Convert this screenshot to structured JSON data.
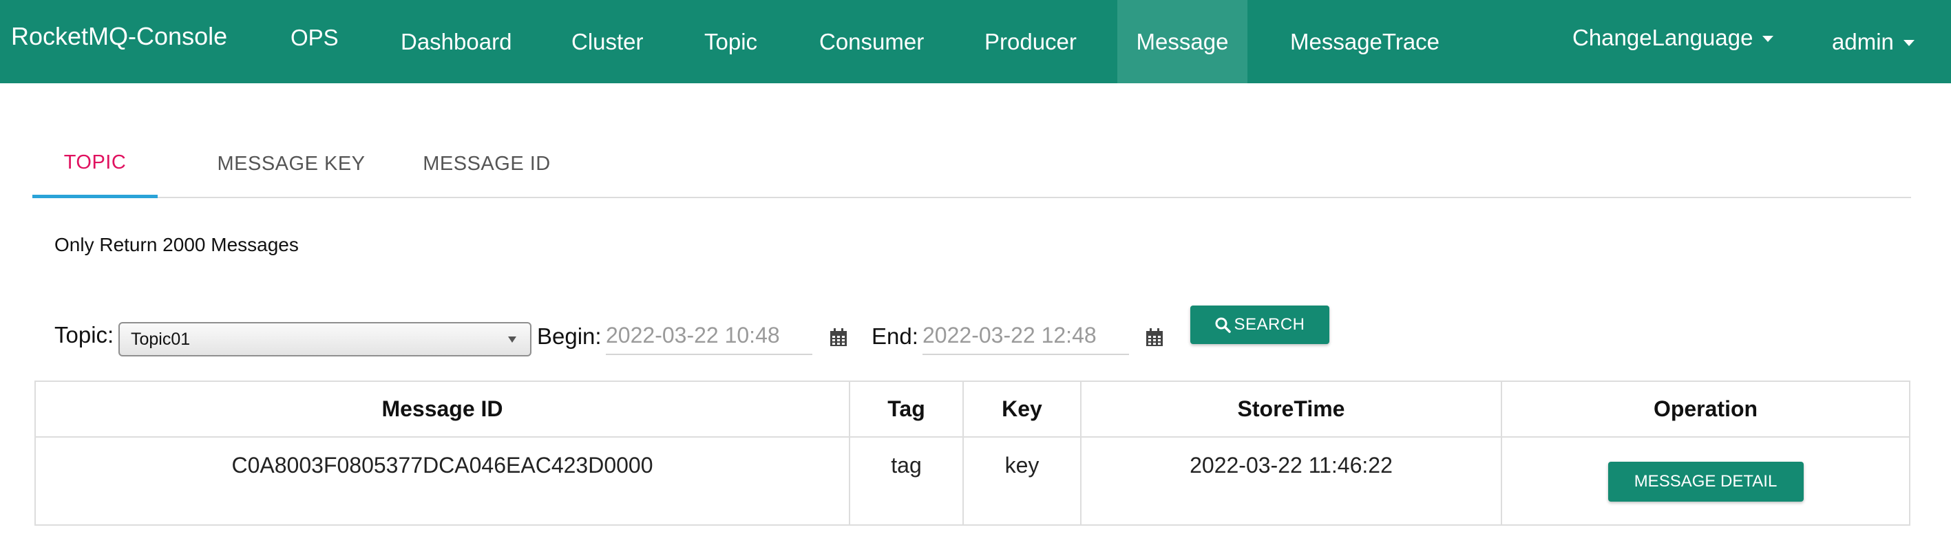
{
  "nav": {
    "brand": "RocketMQ-Console",
    "items": [
      {
        "label": "OPS"
      },
      {
        "label": "Dashboard"
      },
      {
        "label": "Cluster"
      },
      {
        "label": "Topic"
      },
      {
        "label": "Consumer"
      },
      {
        "label": "Producer"
      },
      {
        "label": "Message"
      },
      {
        "label": "MessageTrace"
      }
    ],
    "active": "Message",
    "language": "ChangeLanguage",
    "user": "admin"
  },
  "tabs": [
    {
      "label": "TOPIC",
      "active": true
    },
    {
      "label": "MESSAGE KEY",
      "active": false
    },
    {
      "label": "MESSAGE ID",
      "active": false
    }
  ],
  "notice": "Only Return 2000 Messages",
  "search": {
    "topic_label": "Topic:",
    "topic_value": "Topic01",
    "begin_label": "Begin:",
    "begin_value": "2022-03-22 10:48",
    "end_label": "End:",
    "end_value": "2022-03-22 12:48",
    "search_button": "SEARCH"
  },
  "table": {
    "headers": [
      "Message ID",
      "Tag",
      "Key",
      "StoreTime",
      "Operation"
    ],
    "rows": [
      {
        "message_id": "C0A8003F0805377DCA046EAC423D0000",
        "tag": "tag",
        "key": "key",
        "store_time": "2022-03-22 11:46:22",
        "operation": "MESSAGE DETAIL"
      }
    ]
  },
  "colors": {
    "primary": "#148a72",
    "active_nav": "#2f9a84",
    "active_tab_text": "#e0115f",
    "active_tab_underline": "#2aa3d8"
  }
}
